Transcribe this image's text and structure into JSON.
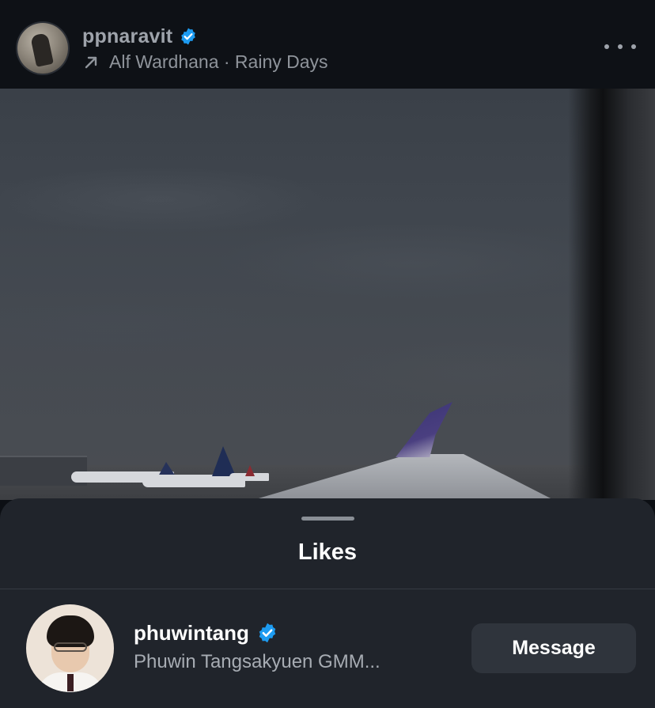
{
  "post": {
    "username": "ppnaravit",
    "music": "Alf Wardhana · Rainy Days",
    "colors": {
      "verified": "#1d9bf0"
    }
  },
  "likes_sheet": {
    "title": "Likes",
    "users": [
      {
        "username": "phuwintang",
        "full_name": "Phuwin Tangsakyuen GMM...",
        "action_label": "Message"
      }
    ]
  }
}
